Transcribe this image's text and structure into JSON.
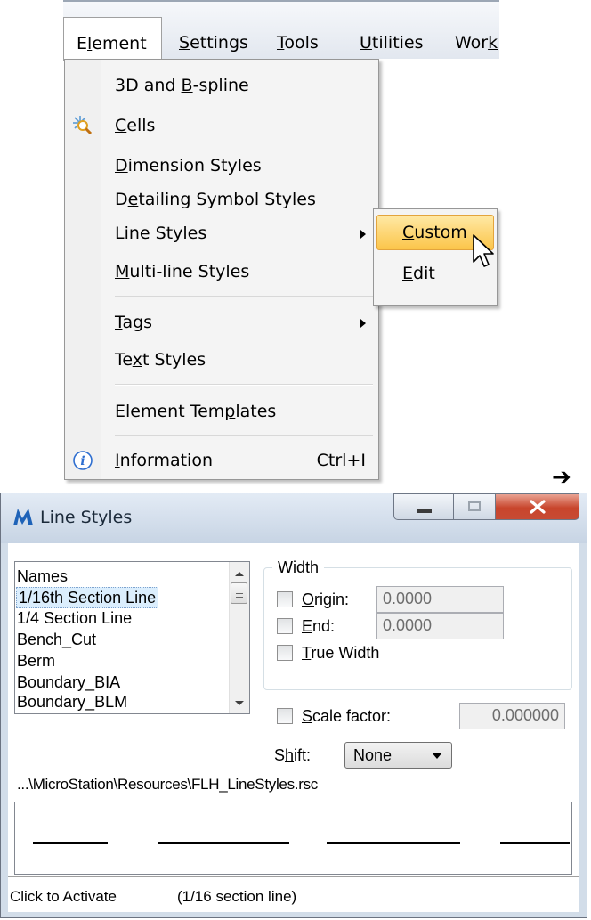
{
  "menubar": {
    "items": [
      {
        "label": "Element",
        "active": true
      },
      {
        "label": "Settings"
      },
      {
        "label": "Tools"
      },
      {
        "label": "Utilities"
      },
      {
        "label": "Work"
      }
    ]
  },
  "element_menu": {
    "items": [
      {
        "label": "3D and B-spline",
        "icon": null
      },
      {
        "label": "Cells",
        "icon": "cell-magnifier-icon"
      },
      {
        "label": "Dimension Styles"
      },
      {
        "label": "Detailing Symbol Styles"
      },
      {
        "label": "Line Styles",
        "submenu": true
      },
      {
        "label": "Multi-line Styles"
      },
      {
        "label": "Tags",
        "submenu": true
      },
      {
        "label": "Text Styles"
      },
      {
        "label": "Element Templates"
      },
      {
        "label": "Information",
        "shortcut": "Ctrl+I",
        "icon": "info-icon"
      }
    ]
  },
  "line_styles_submenu": {
    "items": [
      {
        "label": "Custom",
        "highlighted": true
      },
      {
        "label": "Edit"
      }
    ]
  },
  "arrow_glyph": "➔",
  "dialog": {
    "title": "Line Styles",
    "names_header": "Names",
    "names": [
      "1/16th Section Line",
      "1/4 Section Line",
      "Bench_Cut",
      "Berm",
      "Boundary_BIA",
      "Boundary_BLM"
    ],
    "selected_index": 0,
    "width_group": {
      "title": "Width",
      "origin_label": "Origin:",
      "origin_value": "0.0000",
      "end_label": "End:",
      "end_value": "0.0000",
      "true_width_label": "True Width"
    },
    "scale_label": "Scale factor:",
    "scale_value": "0.000000",
    "shift_label": "Shift:",
    "shift_value": "None",
    "resource_path": "...\\MicroStation\\Resources\\FLH_LineStyles.rsc",
    "status_left": "Click to Activate",
    "status_right": "(1/16 section line)",
    "colors": {
      "title_bg": "#d2dde9",
      "close_red": "#c8452c",
      "highlight": "#fbc54a"
    }
  }
}
